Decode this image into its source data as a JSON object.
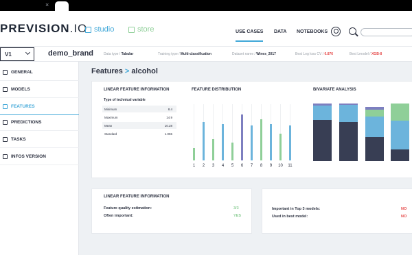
{
  "browser": {
    "close_glyph": "×"
  },
  "header": {
    "logo_main": "PREVISION",
    "logo_suffix": ".IO",
    "apps": [
      {
        "label": "studio"
      },
      {
        "label": "store"
      }
    ],
    "nav": [
      {
        "label": "USE CASES"
      },
      {
        "label": "DATA"
      },
      {
        "label": "NOTEBOOKS"
      }
    ],
    "icons": [
      "user-icon",
      "search-icon"
    ]
  },
  "subbar": {
    "version": "V1",
    "project": "demo_brand",
    "meta": [
      {
        "label": "Data type / ",
        "value": "Tabular"
      },
      {
        "label": "Training type / ",
        "value": "Multi-classification"
      },
      {
        "label": "Dataset name / ",
        "value": "Wines_2017"
      },
      {
        "label": "Best Log loss CV / ",
        "value": "0.876"
      },
      {
        "label": "Best Lmodel / ",
        "value": "XGB-8"
      }
    ]
  },
  "sidebar": {
    "items": [
      {
        "label": "GENERAL"
      },
      {
        "label": "MODELS"
      },
      {
        "label": "FEATURES"
      },
      {
        "label": "PREDICTIONS"
      },
      {
        "label": "TASKS"
      },
      {
        "label": "INFOS VERSION"
      }
    ]
  },
  "page": {
    "crumb": "Features",
    "sep": " > ",
    "feature": "alcohol"
  },
  "linear_info": {
    "title": "LINEAR FEATURE INFORMATION",
    "subtitle": "Type of technical variable",
    "rows": [
      {
        "label": "Minimum",
        "value": "8.4"
      },
      {
        "label": "Maximum",
        "value": "14.9"
      },
      {
        "label": "Mean",
        "value": "10.28"
      },
      {
        "label": "Standard",
        "value": "1.055"
      }
    ]
  },
  "distribution": {
    "title": "FEATURE DISTRIBUTION"
  },
  "bivariate": {
    "title": "BIVARIATE ANALYSIS"
  },
  "chart_data": [
    {
      "type": "bar",
      "title": "FEATURE DISTRIBUTION",
      "categories": [
        "1",
        "2",
        "3",
        "4",
        "5",
        "6",
        "7",
        "8",
        "9",
        "10",
        "11"
      ],
      "values": [
        0.22,
        0.68,
        0.38,
        0.65,
        0.32,
        0.82,
        0.62,
        0.73,
        0.65,
        0.48,
        0.62
      ],
      "bar_colors": [
        "#8fcf98",
        "#6cb4dc",
        "#8fcf98",
        "#6cb4dc",
        "#8fcf98",
        "#7d7fc0",
        "#6cb4dc",
        "#8fcf98",
        "#6cb4dc",
        "#8fcf98",
        "#6cb4dc"
      ],
      "ylim": [
        0,
        1
      ]
    },
    {
      "type": "bar",
      "title": "BIVARIATE ANALYSIS",
      "categories": [
        "",
        "",
        "",
        ""
      ],
      "series": [
        {
          "color": "#383e54",
          "values": [
            0.72,
            0.68,
            0.42,
            0.2
          ]
        },
        {
          "color": "#6cb4dc",
          "values": [
            0.25,
            0.3,
            0.36,
            0.5
          ]
        },
        {
          "color": "#8fcf98",
          "values": [
            0.0,
            0.0,
            0.12,
            0.3
          ]
        },
        {
          "color": "#7d7fc0",
          "values": [
            0.03,
            0.02,
            0.05,
            0.0
          ]
        }
      ],
      "ylim": [
        0,
        1
      ]
    }
  ],
  "quality": {
    "title": "LINEAR FEATURE INFORMATION",
    "rows": [
      {
        "label": "Feature quality estimation:",
        "value": "3/3"
      },
      {
        "label": "Often important:",
        "value": "YES"
      }
    ]
  },
  "usage": {
    "rows": [
      {
        "label": "Important in Top 3 models:",
        "value": "NO"
      },
      {
        "label": "Used in best model:",
        "value": "NO"
      }
    ]
  },
  "colors": {
    "accent": "#3fa7d8",
    "green": "#8fcf98",
    "red": "#e54848",
    "dark": "#383e54"
  }
}
